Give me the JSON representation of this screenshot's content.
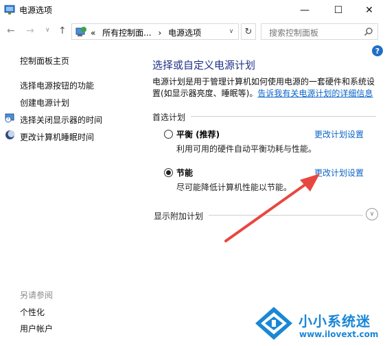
{
  "window": {
    "title": "电源选项",
    "min_symbol": "—",
    "max_symbol": "☐",
    "close_symbol": "✕"
  },
  "nav": {
    "back_symbol": "←",
    "forward_symbol": "→",
    "dropdown_symbol": "∨",
    "up_symbol": "↑",
    "breadcrumb": [
      "«",
      "所有控制面...",
      "›",
      "电源选项"
    ],
    "address_dropdown_symbol": "∨",
    "refresh_symbol": "↻",
    "search_placeholder": "搜索控制面板"
  },
  "help_symbol": "?",
  "sidebar": {
    "home": "控制面板主页",
    "links": [
      "选择电源按钮的功能",
      "创建电源计划",
      "选择关闭显示器的时间",
      "更改计算机睡眠时间"
    ],
    "see_also_title": "另请参阅",
    "see_also": [
      "个性化",
      "用户帐户"
    ]
  },
  "main": {
    "title": "选择或自定义电源计划",
    "description": "电源计划是用于管理计算机如何使用电源的一套硬件和系统设置(如显示器亮度、睡眠等)。",
    "description_link": "告诉我有关电源计划的详细信息",
    "preferred_plans_label": "首选计划",
    "plans": [
      {
        "name": "平衡 (推荐)",
        "desc": "利用可用的硬件自动平衡功耗与性能。",
        "link": "更改计划设置",
        "selected": false
      },
      {
        "name": "节能",
        "desc": "尽可能降低计算机性能以节能。",
        "link": "更改计划设置",
        "selected": true
      }
    ],
    "extra_plans_label": "显示附加计划",
    "expand_symbol": "∨"
  },
  "watermark": {
    "name": "小小系统迷",
    "url": "www.ilovext.com"
  },
  "colors": {
    "accent_title": "#1e3287",
    "link": "#0a64c8",
    "arrow": "#e8473f",
    "watermark": "#1a87d6"
  }
}
